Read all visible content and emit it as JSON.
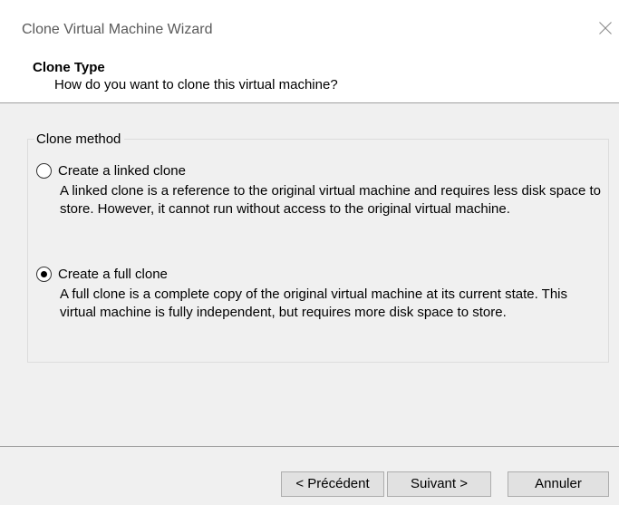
{
  "window": {
    "title": "Clone Virtual Machine Wizard"
  },
  "header": {
    "title": "Clone Type",
    "subtitle": "How do you want to clone this virtual machine?"
  },
  "group": {
    "legend": "Clone method",
    "options": [
      {
        "label": "Create a linked clone",
        "description": "A linked clone is a reference to the original virtual machine and requires less disk space to store. However, it cannot run without access to the original virtual machine.",
        "selected": false
      },
      {
        "label": "Create a full clone",
        "description": "A full clone is a complete copy of the original virtual machine at its current state. This virtual machine is fully independent, but requires more disk space to store.",
        "selected": true
      }
    ]
  },
  "buttons": {
    "previous": "< Précédent",
    "next": "Suivant >",
    "cancel": "Annuler"
  },
  "icons": {
    "close": "close-icon"
  },
  "colors": {
    "title_text": "#5a5a5a",
    "content_background": "#f0f0f0",
    "button_background": "#e1e1e1",
    "button_border": "#adadad"
  }
}
